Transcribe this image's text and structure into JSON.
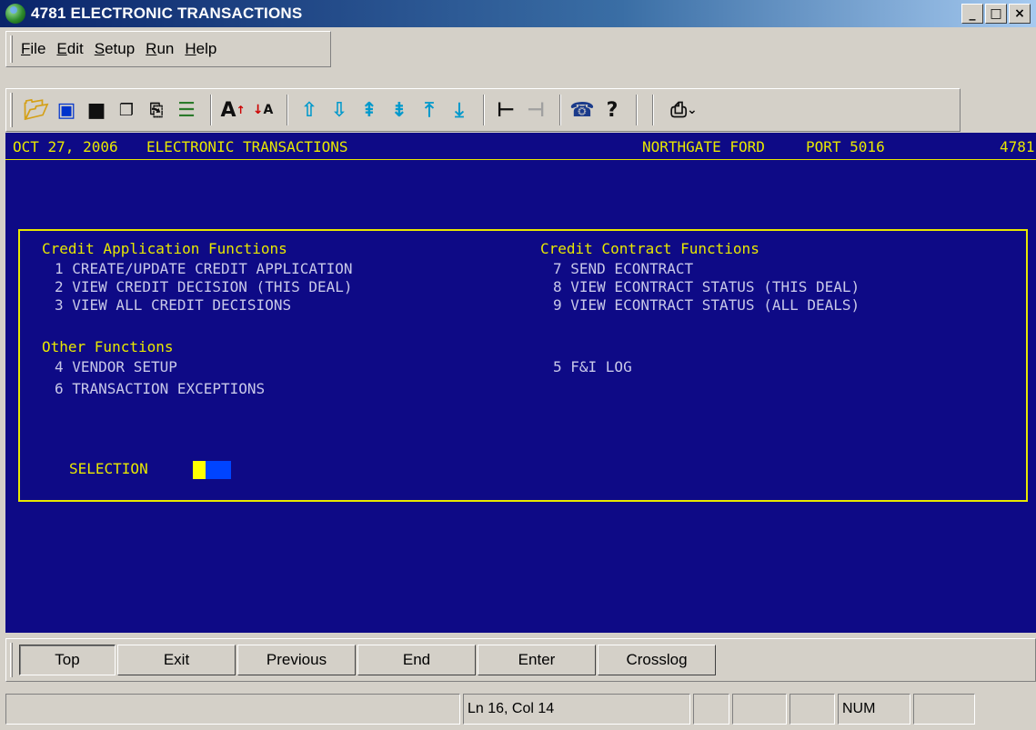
{
  "window": {
    "title": "4781 ELECTRONIC TRANSACTIONS",
    "minimize": "_",
    "maximize": "□",
    "close": "×"
  },
  "menu": [
    {
      "accel": "F",
      "rest": "ile"
    },
    {
      "accel": "E",
      "rest": "dit"
    },
    {
      "accel": "S",
      "rest": "etup"
    },
    {
      "accel": "R",
      "rest": "un"
    },
    {
      "accel": "H",
      "rest": "elp"
    }
  ],
  "toolbar_icons": [
    "open-folder-icon",
    "screen-icon",
    "save-icon",
    "copy-icon",
    "paste-icon",
    "clipboard-list-icon",
    "font-larger-icon",
    "font-smaller-icon",
    "arrow-up-icon",
    "arrow-down-icon",
    "page-up-icon",
    "page-down-icon",
    "top-icon",
    "bottom-icon",
    "connect-icon",
    "disconnect-icon",
    "phone-icon",
    "help-icon",
    "printer-icon"
  ],
  "header": {
    "date": "OCT 27, 2006",
    "screen_title": "ELECTRONIC TRANSACTIONS",
    "dealer": "NORTHGATE FORD",
    "port": "PORT 5016",
    "store": "4781"
  },
  "credit_app": {
    "heading": "Credit Application Functions",
    "items": [
      "1 CREATE/UPDATE CREDIT APPLICATION",
      "2 VIEW CREDIT DECISION (THIS DEAL)",
      "3 VIEW ALL CREDIT DECISIONS"
    ]
  },
  "credit_contract": {
    "heading": "Credit Contract Functions",
    "items": [
      "7 SEND ECONTRACT",
      "8 VIEW ECONTRACT STATUS (THIS DEAL)",
      "9 VIEW ECONTRACT STATUS (ALL DEALS)"
    ]
  },
  "other": {
    "heading": "Other Functions",
    "items": [
      "4 VENDOR SETUP",
      "6 TRANSACTION EXCEPTIONS",
      "5 F&I LOG"
    ]
  },
  "selection_label": "SELECTION",
  "function_keys": [
    "Top",
    "Exit",
    "Previous",
    "End",
    "Enter",
    "Crosslog"
  ],
  "status": {
    "position": "Ln 16, Col 14",
    "num": "NUM"
  },
  "colors": {
    "screen_bg": "#0e0a86",
    "yellow_text": "#e8e800",
    "white_text": "#c8c8e8"
  }
}
